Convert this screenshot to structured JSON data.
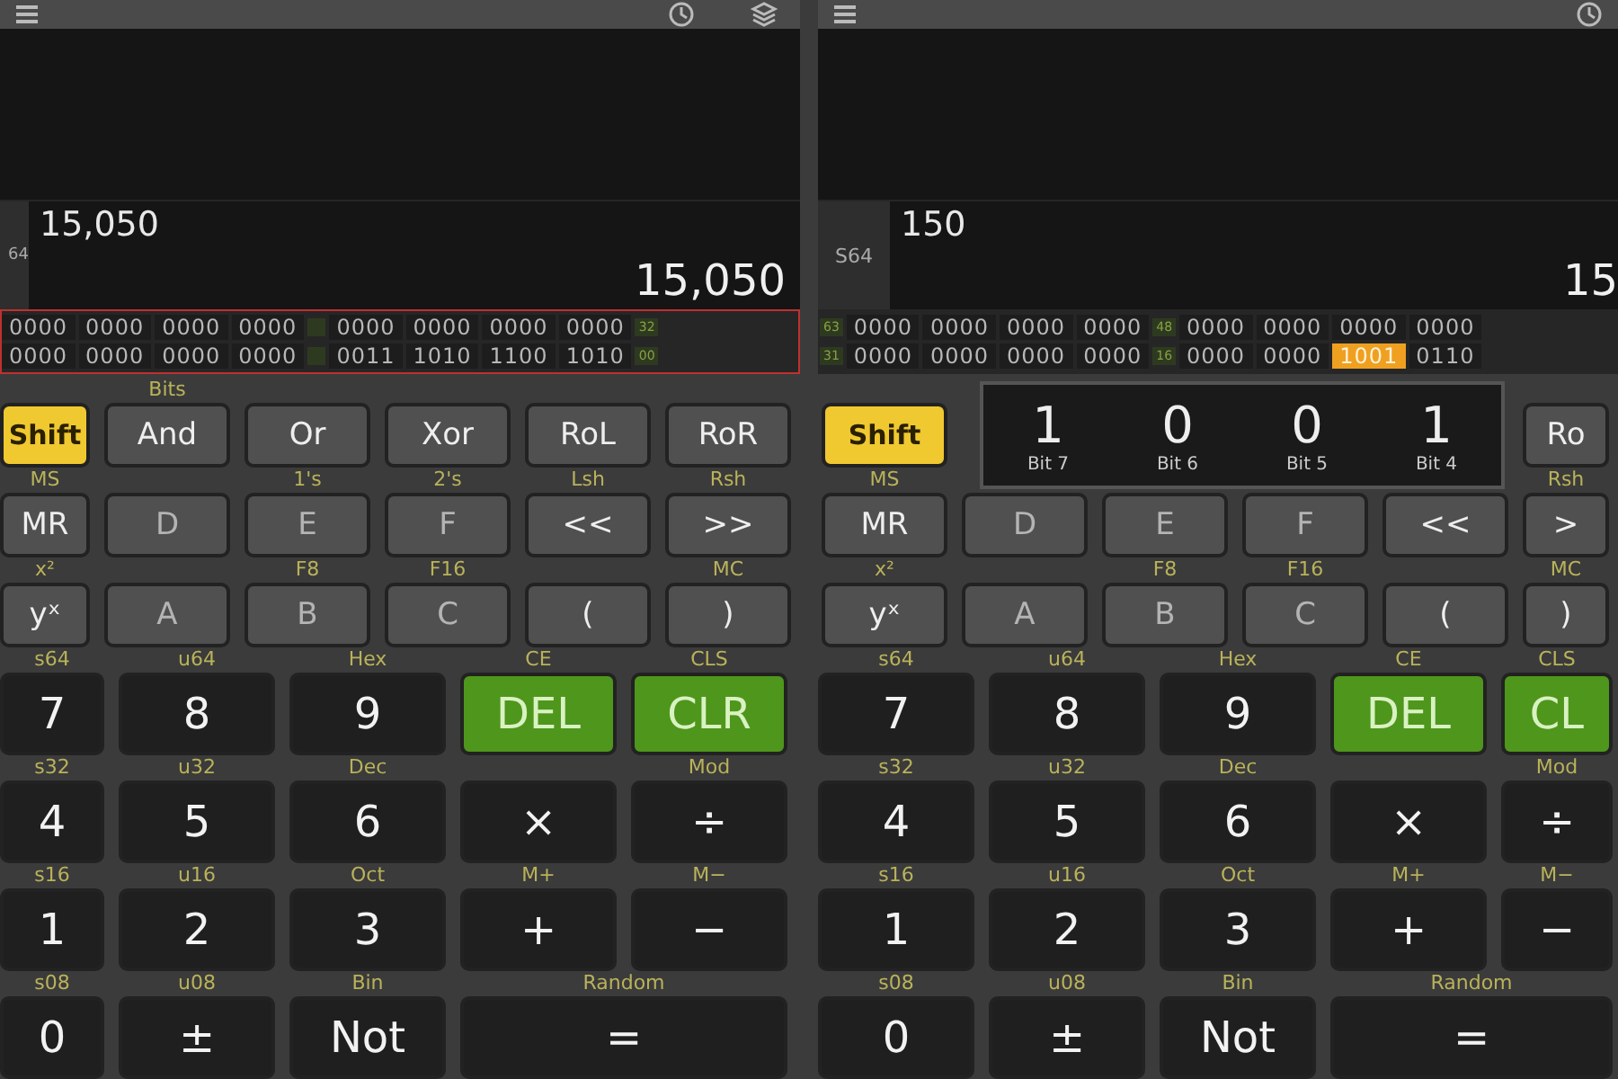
{
  "panels": [
    {
      "toolbar": [
        {
          "kind": "menu"
        },
        {
          "kind": "clock"
        },
        {
          "kind": "layers"
        }
      ],
      "display": {
        "mode": "64",
        "input": "15,050",
        "result": "15,050",
        "bits_focused": true,
        "bit_rows": [
          {
            "end": "32",
            "groups": [
              {
                "text": "0000",
                "selected": false
              },
              {
                "text": "0000",
                "selected": false
              },
              {
                "text": "0000",
                "selected": false
              },
              {
                "text": "0000",
                "selected": false
              },
              {
                "text": "0000",
                "selected": false
              },
              {
                "text": "0000",
                "selected": false
              },
              {
                "text": "0000",
                "selected": false
              },
              {
                "text": "0000",
                "selected": false
              }
            ]
          },
          {
            "end": "00",
            "groups": [
              {
                "text": "0000",
                "selected": false
              },
              {
                "text": "0000",
                "selected": false
              },
              {
                "text": "0000",
                "selected": false
              },
              {
                "text": "0000",
                "selected": false
              },
              {
                "text": "0011",
                "selected": false
              },
              {
                "text": "1010",
                "selected": false
              },
              {
                "text": "1100",
                "selected": false
              },
              {
                "text": "1010",
                "selected": false
              }
            ]
          }
        ]
      },
      "key_rows": [
        [
          {
            "label": "Shift",
            "kind": "shift",
            "disabled": false
          },
          {
            "label": "And",
            "alt": "Bits",
            "kind": "func",
            "disabled": false
          },
          {
            "label": "Or",
            "kind": "func",
            "disabled": false
          },
          {
            "label": "Xor",
            "kind": "func",
            "disabled": false
          },
          {
            "label": "RoL",
            "kind": "func",
            "disabled": false
          },
          {
            "label": "RoR",
            "kind": "func",
            "disabled": false
          }
        ],
        [
          {
            "label": "MR",
            "alt": "MS",
            "kind": "func",
            "disabled": false
          },
          {
            "label": "D",
            "kind": "func",
            "disabled": true
          },
          {
            "label": "E",
            "alt": "1's",
            "kind": "func",
            "disabled": true
          },
          {
            "label": "F",
            "alt": "2's",
            "kind": "func",
            "disabled": true
          },
          {
            "label": "<<",
            "alt": "Lsh",
            "kind": "func",
            "disabled": false
          },
          {
            "label": ">>",
            "alt": "Rsh",
            "kind": "func",
            "disabled": false
          }
        ],
        [
          {
            "label": "yˣ",
            "alt": "x²",
            "kind": "func",
            "disabled": false
          },
          {
            "label": "A",
            "kind": "func",
            "disabled": true
          },
          {
            "label": "B",
            "alt": "F8",
            "kind": "func",
            "disabled": true
          },
          {
            "label": "C",
            "alt": "F16",
            "kind": "func",
            "disabled": true
          },
          {
            "label": "(",
            "kind": "func",
            "disabled": false
          },
          {
            "label": ")",
            "alt": "MC",
            "kind": "func",
            "disabled": false
          }
        ],
        [
          {
            "label": "7",
            "alt": "s64",
            "kind": "digit",
            "disabled": false
          },
          {
            "label": "8",
            "alt": "u64",
            "kind": "digit",
            "disabled": false
          },
          {
            "label": "9",
            "alt": "Hex",
            "kind": "digit",
            "disabled": false
          },
          {
            "label": "DEL",
            "alt": "CE",
            "kind": "action",
            "disabled": false
          },
          {
            "label": "CLR",
            "alt": "CLS",
            "kind": "action",
            "disabled": false
          }
        ],
        [
          {
            "label": "4",
            "alt": "s32",
            "kind": "digit",
            "disabled": false
          },
          {
            "label": "5",
            "alt": "u32",
            "kind": "digit",
            "disabled": false
          },
          {
            "label": "6",
            "alt": "Dec",
            "kind": "digit",
            "disabled": false
          },
          {
            "label": "×",
            "kind": "digit",
            "disabled": false
          },
          {
            "label": "÷",
            "alt": "Mod",
            "kind": "digit",
            "disabled": false
          }
        ],
        [
          {
            "label": "1",
            "alt": "s16",
            "kind": "digit",
            "disabled": false
          },
          {
            "label": "2",
            "alt": "u16",
            "kind": "digit",
            "disabled": false
          },
          {
            "label": "3",
            "alt": "Oct",
            "kind": "digit",
            "disabled": false
          },
          {
            "label": "+",
            "alt": "M+",
            "kind": "digit",
            "disabled": false
          },
          {
            "label": "−",
            "alt": "M−",
            "kind": "digit",
            "disabled": false
          }
        ],
        [
          {
            "label": "0",
            "alt": "s08",
            "kind": "digit",
            "disabled": false
          },
          {
            "label": "±",
            "alt": "u08",
            "kind": "digit",
            "disabled": false
          },
          {
            "label": "Not",
            "alt": "Bin",
            "kind": "digit",
            "disabled": false
          },
          {
            "label": "=",
            "alt": "Random",
            "kind": "wide",
            "disabled": false
          }
        ]
      ]
    },
    {
      "toolbar": [
        {
          "kind": "menu"
        },
        {
          "kind": "clock"
        }
      ],
      "display": {
        "mode": "S64",
        "input": "150",
        "result": "15",
        "bits_focused": false,
        "bit_rows": [
          {
            "start": "63",
            "mid": "48",
            "groups": [
              {
                "text": "0000",
                "selected": false
              },
              {
                "text": "0000",
                "selected": false
              },
              {
                "text": "0000",
                "selected": false
              },
              {
                "text": "0000",
                "selected": false
              },
              {
                "text": "0000",
                "selected": false
              },
              {
                "text": "0000",
                "selected": false
              },
              {
                "text": "0000",
                "selected": false
              },
              {
                "text": "0000",
                "selected": false
              }
            ]
          },
          {
            "start": "31",
            "mid": "16",
            "groups": [
              {
                "text": "0000",
                "selected": false
              },
              {
                "text": "0000",
                "selected": false
              },
              {
                "text": "0000",
                "selected": false
              },
              {
                "text": "0000",
                "selected": false
              },
              {
                "text": "0000",
                "selected": false
              },
              {
                "text": "0000",
                "selected": false
              },
              {
                "text": "1001",
                "selected": true
              },
              {
                "text": "0110",
                "selected": false
              }
            ]
          }
        ]
      },
      "bit_popup": [
        {
          "digit": "1",
          "label": "Bit 7"
        },
        {
          "digit": "0",
          "label": "Bit 6"
        },
        {
          "digit": "0",
          "label": "Bit 5"
        },
        {
          "digit": "1",
          "label": "Bit 4"
        }
      ],
      "key_rows": [
        [
          {
            "label": "Shift",
            "kind": "shift",
            "disabled": false
          },
          {
            "kind": "covered"
          },
          {
            "kind": "covered"
          },
          {
            "kind": "covered"
          },
          {
            "kind": "covered"
          },
          {
            "label": "Ro",
            "kind": "func",
            "disabled": false
          }
        ],
        [
          {
            "label": "MR",
            "alt": "MS",
            "kind": "func",
            "disabled": false
          },
          {
            "label": "D",
            "kind": "func",
            "disabled": true
          },
          {
            "label": "E",
            "kind": "func",
            "disabled": true
          },
          {
            "label": "F",
            "kind": "func",
            "disabled": true
          },
          {
            "label": "<<",
            "kind": "func",
            "disabled": false
          },
          {
            "label": ">",
            "alt": "Rsh",
            "kind": "func",
            "disabled": false
          }
        ],
        [
          {
            "label": "yˣ",
            "alt": "x²",
            "kind": "func",
            "disabled": false
          },
          {
            "label": "A",
            "kind": "func",
            "disabled": true
          },
          {
            "label": "B",
            "alt": "F8",
            "kind": "func",
            "disabled": true
          },
          {
            "label": "C",
            "alt": "F16",
            "kind": "func",
            "disabled": true
          },
          {
            "label": "(",
            "kind": "func",
            "disabled": false
          },
          {
            "label": ")",
            "alt": "MC",
            "kind": "func",
            "disabled": false
          }
        ],
        [
          {
            "label": "7",
            "alt": "s64",
            "kind": "digit",
            "disabled": false
          },
          {
            "label": "8",
            "alt": "u64",
            "kind": "digit",
            "disabled": false
          },
          {
            "label": "9",
            "alt": "Hex",
            "kind": "digit",
            "disabled": false
          },
          {
            "label": "DEL",
            "alt": "CE",
            "kind": "action",
            "disabled": false
          },
          {
            "label": "CL",
            "alt": "CLS",
            "kind": "action",
            "disabled": false
          }
        ],
        [
          {
            "label": "4",
            "alt": "s32",
            "kind": "digit",
            "disabled": false
          },
          {
            "label": "5",
            "alt": "u32",
            "kind": "digit",
            "disabled": false
          },
          {
            "label": "6",
            "alt": "Dec",
            "kind": "digit",
            "disabled": false
          },
          {
            "label": "×",
            "kind": "digit",
            "disabled": false
          },
          {
            "label": "÷",
            "alt": "Mod",
            "kind": "digit",
            "disabled": false
          }
        ],
        [
          {
            "label": "1",
            "alt": "s16",
            "kind": "digit",
            "disabled": false
          },
          {
            "label": "2",
            "alt": "u16",
            "kind": "digit",
            "disabled": false
          },
          {
            "label": "3",
            "alt": "Oct",
            "kind": "digit",
            "disabled": false
          },
          {
            "label": "+",
            "alt": "M+",
            "kind": "digit",
            "disabled": false
          },
          {
            "label": "−",
            "alt": "M−",
            "kind": "digit",
            "disabled": false
          }
        ],
        [
          {
            "label": "0",
            "alt": "s08",
            "kind": "digit",
            "disabled": false
          },
          {
            "label": "±",
            "alt": "u08",
            "kind": "digit",
            "disabled": false
          },
          {
            "label": "Not",
            "alt": "Bin",
            "kind": "digit",
            "disabled": false
          },
          {
            "label": "=",
            "alt": "Random",
            "kind": "wide",
            "disabled": false
          }
        ]
      ]
    }
  ]
}
